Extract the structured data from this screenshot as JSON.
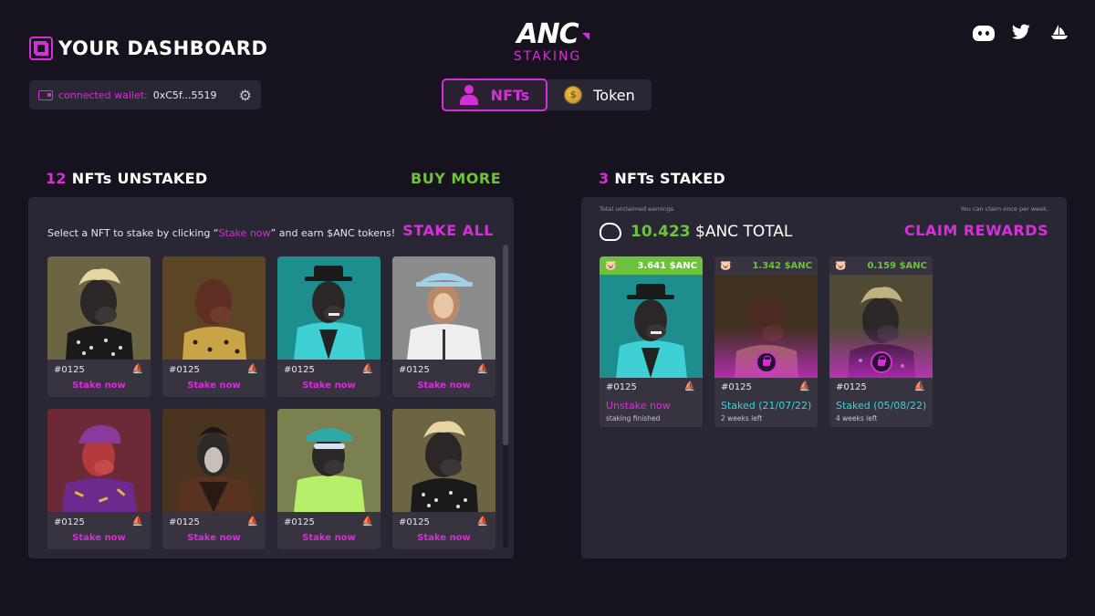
{
  "header": {
    "title": "YOUR DASHBOARD",
    "wallet_label": "connected wallet:",
    "wallet_address": "0xC5f...5519",
    "logo_main": "ANC",
    "logo_sub": "STAKING",
    "toggle_nfts": "NFTs",
    "toggle_token": "Token",
    "socials": [
      "discord-icon",
      "twitter-icon",
      "opensea-icon"
    ]
  },
  "unstaked": {
    "count": "12",
    "heading": "NFTs UNSTAKED",
    "buy_more": "BUY MORE",
    "instruction_pre": "Select a NFT to stake by clicking “",
    "instruction_link": "Stake now",
    "instruction_post": "” and earn $ANC tokens!",
    "stake_all": "STAKE ALL",
    "cards": [
      {
        "id": "#0125",
        "action": "Stake now"
      },
      {
        "id": "#0125",
        "action": "Stake now"
      },
      {
        "id": "#0125",
        "action": "Stake now"
      },
      {
        "id": "#0125",
        "action": "Stake now"
      },
      {
        "id": "#0125",
        "action": "Stake now"
      },
      {
        "id": "#0125",
        "action": "Stake now"
      },
      {
        "id": "#0125",
        "action": "Stake now"
      },
      {
        "id": "#0125",
        "action": "Stake now"
      }
    ]
  },
  "staked": {
    "count": "3",
    "heading": "NFTs STAKED",
    "earnings_label": "Total unclaimed earnings",
    "claim_note": "You can claim once per week.",
    "total_value": "10.423",
    "total_suffix": "$ANC TOTAL",
    "claim_rewards": "CLAIM REWARDS",
    "cards": [
      {
        "earned": "3.641 $ANC",
        "id": "#0125",
        "status": "Unstake now",
        "sub": "staking finished"
      },
      {
        "earned": "1.342 $ANC",
        "id": "#0125",
        "status": "Staked (21/07/22)",
        "sub": "2 weeks left"
      },
      {
        "earned": "0.159 $ANC",
        "id": "#0125",
        "status": "Staked (05/08/22)",
        "sub": "4 weeks left"
      }
    ]
  },
  "colors": {
    "accent": "#d62ed9",
    "green": "#6cc23a",
    "teal": "#3fd0d4",
    "background": "#16131f",
    "panel": "#2a2734"
  }
}
